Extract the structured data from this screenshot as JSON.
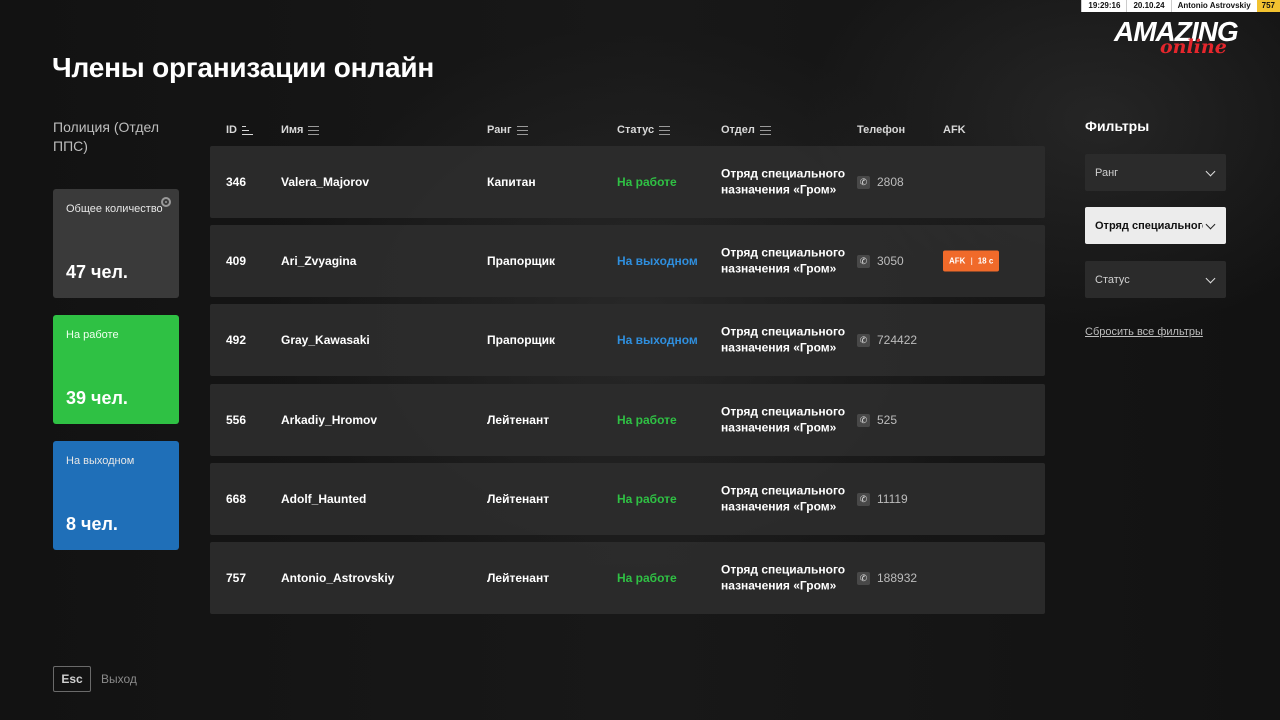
{
  "status_bar": {
    "time": "19:29:16",
    "date": "20.10.24",
    "player": "Antonio Astrovskiy",
    "level": "757"
  },
  "logo": {
    "main": "AMAZING",
    "sub": "online"
  },
  "page_title": "Члены организации онлайн",
  "org_name": "Полиция (Отдел ППС)",
  "stats": {
    "total": {
      "label": "Общее количество",
      "value": "47 чел."
    },
    "working": {
      "label": "На работе",
      "value": "39 чел."
    },
    "off_duty": {
      "label": "На выходном",
      "value": "8 чел."
    }
  },
  "table": {
    "headers": {
      "id": "ID",
      "name": "Имя",
      "rank": "Ранг",
      "status": "Статус",
      "dept": "Отдел",
      "phone": "Телефон",
      "afk": "AFK"
    },
    "rows": [
      {
        "id": "346",
        "name": "Valera_Majorov",
        "rank": "Капитан",
        "status": "На работе",
        "status_type": "work",
        "dept": "Отряд специального назначения «Гром»",
        "phone": "2808",
        "afk": "",
        "afk_time": ""
      },
      {
        "id": "409",
        "name": "Ari_Zvyagina",
        "rank": "Прапорщик",
        "status": "На выходном",
        "status_type": "off",
        "dept": "Отряд специального назначения «Гром»",
        "phone": "3050",
        "afk": "AFK",
        "afk_time": "18 с"
      },
      {
        "id": "492",
        "name": "Gray_Kawasaki",
        "rank": "Прапорщик",
        "status": "На выходном",
        "status_type": "off",
        "dept": "Отряд специального назначения «Гром»",
        "phone": "724422",
        "afk": "",
        "afk_time": ""
      },
      {
        "id": "556",
        "name": "Arkadiy_Hromov",
        "rank": "Лейтенант",
        "status": "На работе",
        "status_type": "work",
        "dept": "Отряд специального назначения «Гром»",
        "phone": "525",
        "afk": "",
        "afk_time": ""
      },
      {
        "id": "668",
        "name": "Adolf_Haunted",
        "rank": "Лейтенант",
        "status": "На работе",
        "status_type": "work",
        "dept": "Отряд специального назначения «Гром»",
        "phone": "11119",
        "afk": "",
        "afk_time": ""
      },
      {
        "id": "757",
        "name": "Antonio_Astrovskiy",
        "rank": "Лейтенант",
        "status": "На работе",
        "status_type": "work",
        "dept": "Отряд специального назначения «Гром»",
        "phone": "188932",
        "afk": "",
        "afk_time": ""
      }
    ]
  },
  "filters": {
    "title": "Фильтры",
    "rank": {
      "value": "Ранг"
    },
    "dept": {
      "value": "Отряд специального назначения «Гром»"
    },
    "status": {
      "value": "Статус"
    },
    "reset_label": "Сбросить все фильтры"
  },
  "exit": {
    "key": "Esc",
    "label": "Выход"
  },
  "colors": {
    "work": "#2fc144",
    "off": "#2f8fde",
    "afk": "#f06a2a",
    "card_total": "#3a3a3a",
    "card_work": "#2fc144",
    "card_off": "#1f6fb8"
  }
}
